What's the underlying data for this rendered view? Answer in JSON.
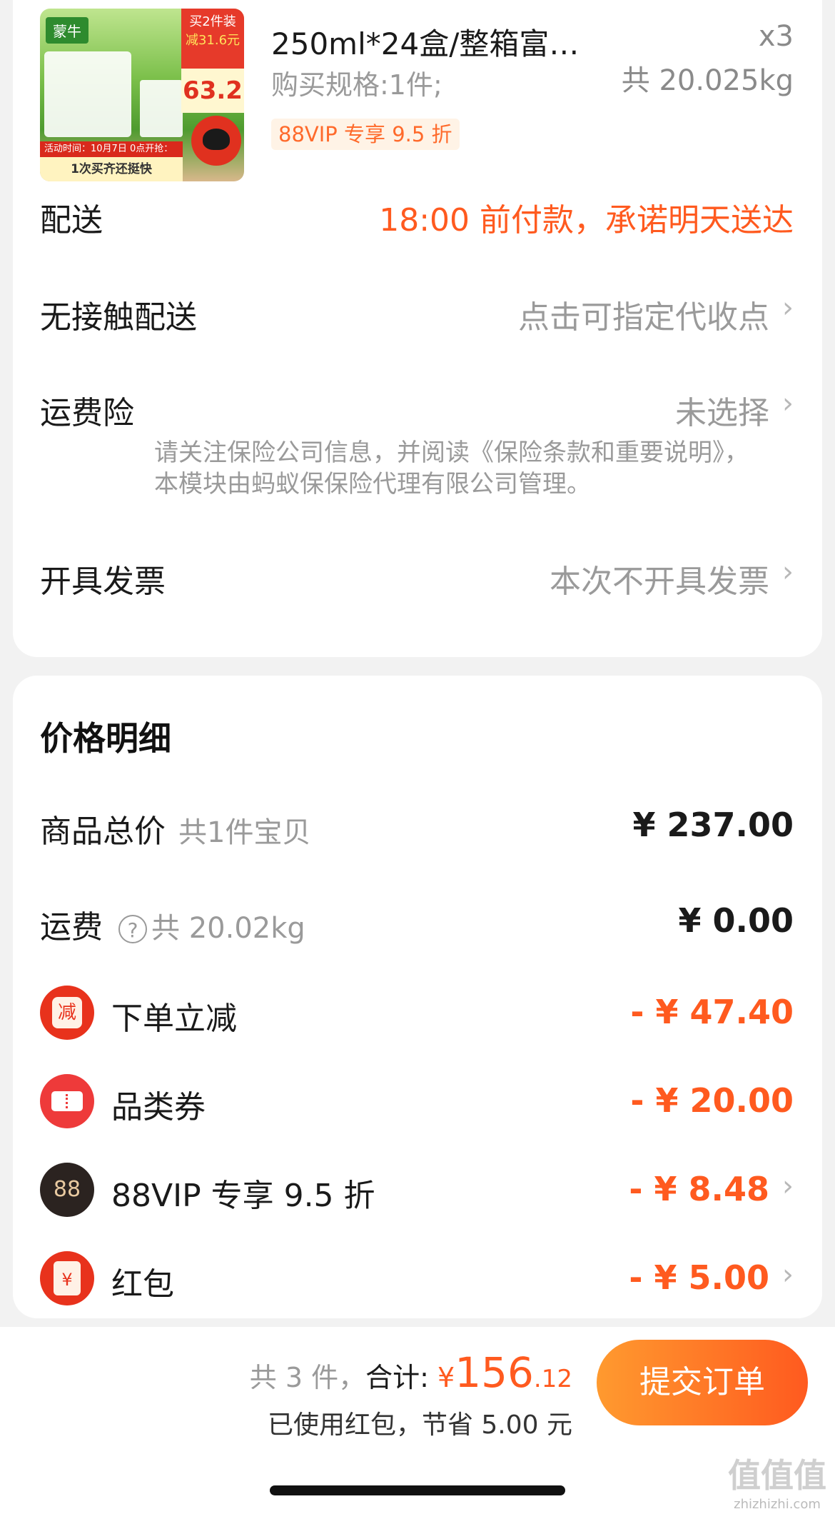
{
  "product": {
    "image_badge_line1": "买2件装",
    "image_badge_line2": "减31.6元",
    "image_price": "63.2",
    "image_brand": "蒙牛",
    "image_strip_line1": "活动时间：10月7日 0点开抢：",
    "image_strip_line2": "1次买齐还挺快",
    "title": "250ml*24盒/整箱富…",
    "spec": "购买规格:1件;",
    "vip_tag": "88VIP 专享 9.5 折",
    "qty": "x3",
    "weight": "共 20.025kg"
  },
  "delivery": {
    "label": "配送",
    "value": "18:00 前付款，承诺明天送达"
  },
  "contactless": {
    "label": "无接触配送",
    "value": "点击可指定代收点"
  },
  "insurance": {
    "label": "运费险",
    "value": "未选择",
    "note": "请关注保险公司信息，并阅读《保险条款和重要说明》，本模块由蚂蚁保保险代理有限公司管理。"
  },
  "invoice": {
    "label": "开具发票",
    "value": "本次不开具发票"
  },
  "price_detail": {
    "title": "价格明细",
    "goods_total_label": "商品总价",
    "goods_total_sub": "共1件宝贝",
    "goods_total_value": "¥ 237.00",
    "shipping_label": "运费",
    "shipping_help": "?",
    "shipping_sub": "共 20.02kg",
    "shipping_value": "¥ 0.00",
    "discounts": [
      {
        "icon_text": "减",
        "label": "下单立减",
        "value": "- ¥ 47.40"
      },
      {
        "icon_text": "",
        "label": "品类券",
        "value": "- ¥ 20.00"
      },
      {
        "icon_text": "88",
        "label": "88VIP 专享 9.5 折",
        "value": "- ¥ 8.48"
      },
      {
        "icon_text": "¥",
        "label": "红包",
        "value": "- ¥ 5.00"
      }
    ]
  },
  "footer": {
    "count": "共 3 件，",
    "total_label": "合计:",
    "currency": "¥",
    "total_int": "156",
    "total_dec": ".12",
    "saved": "已使用红包，节省 5.00 元",
    "submit": "提交订单"
  },
  "watermark": {
    "line1": "值值值",
    "line2": "zhizhizhi.com"
  },
  "colors": {
    "accent": "#ff5a1f",
    "gray": "#9a9a9a",
    "background": "#f2f2f2"
  }
}
